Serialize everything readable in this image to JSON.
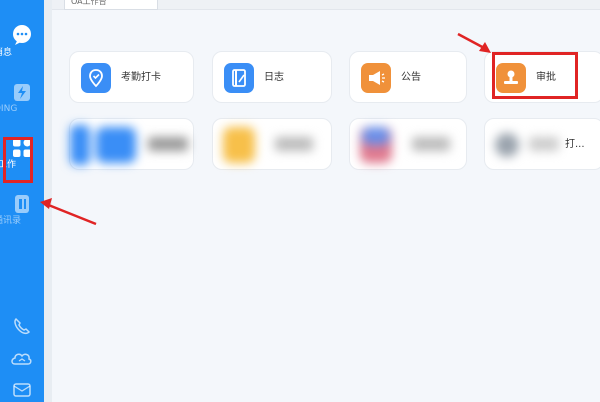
{
  "sidebar": {
    "items": [
      {
        "label": "消息",
        "icon": "chat-bubble-icon"
      },
      {
        "label": "DING",
        "icon": "lightning-icon"
      },
      {
        "label": "工作",
        "icon": "grid-icon"
      },
      {
        "label": "通讯录",
        "icon": "address-book-icon"
      }
    ],
    "bottom_icons": [
      "phone-icon",
      "cloud-icon",
      "mail-icon"
    ]
  },
  "header": {
    "tab_label": "OA工作台"
  },
  "apps_row1": [
    {
      "label": "考勤打卡",
      "icon": "location-pin-icon",
      "color": "#3a8ef6"
    },
    {
      "label": "日志",
      "icon": "notebook-pen-icon",
      "color": "#3a8ef6"
    },
    {
      "label": "公告",
      "icon": "megaphone-icon",
      "color": "#f0913a"
    },
    {
      "label": "审批",
      "icon": "stamp-icon",
      "color": "#f0913a"
    }
  ],
  "apps_row2_partial_label": "打..."
}
